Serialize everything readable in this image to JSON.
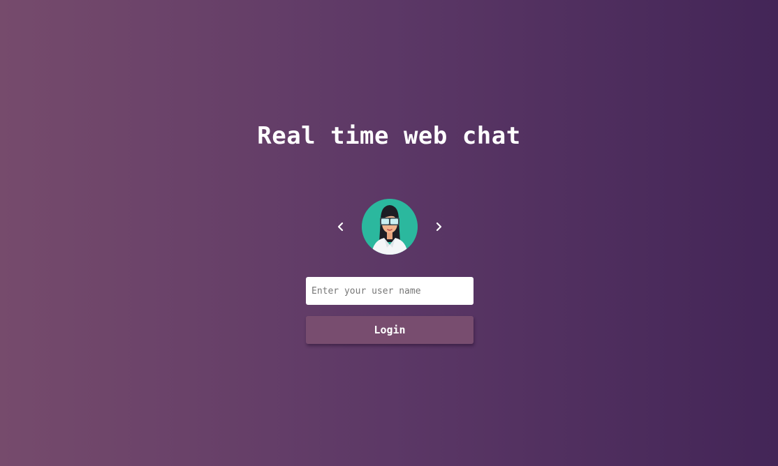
{
  "title": "Real time web chat",
  "avatar": {
    "icon": "avatar-woman-vr-goggles",
    "background": "#2bb89e",
    "prev_icon": "chevron-left-icon",
    "next_icon": "chevron-right-icon"
  },
  "login_form": {
    "username_placeholder": "Enter your user name",
    "username_value": "",
    "login_label": "Login"
  },
  "colors": {
    "gradient_left": "#764b6c",
    "gradient_right": "#432557",
    "button": "#784d6f",
    "text": "#ffffff"
  }
}
